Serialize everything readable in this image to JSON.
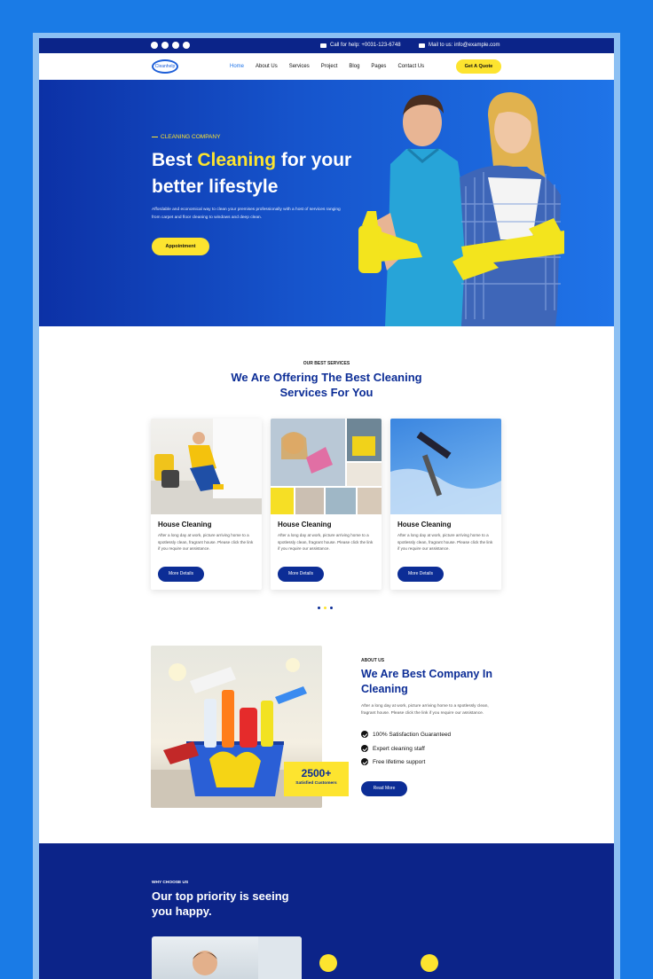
{
  "topbar": {
    "social_icons": [
      "facebook-icon",
      "instagram-icon",
      "twitter-icon",
      "dribbble-icon"
    ],
    "phone_text": "Call for help: +0031-123-6748",
    "mail_text": "Mail to us: info@example.com"
  },
  "nav": {
    "logo_text": "Cleanhelp",
    "items": [
      "Home",
      "About Us",
      "Services",
      "Project",
      "Blog",
      "Pages",
      "Contact Us"
    ],
    "active": "Home",
    "cta": "Get A Quote"
  },
  "hero": {
    "eyebrow": "CLEANING COMPANY",
    "title_part1": "Best ",
    "title_highlight": "Cleaning",
    "title_part2": " for your better lifestyle",
    "description": "Affordable and economical way to clean your premises professionally with a host of services ranging from carpet and floor cleaning to windows and deep clean.",
    "button": "Appointment"
  },
  "services": {
    "eyebrow": "OUR BEST SERVICES",
    "title": "We Are Offering The Best Cleaning Services For You",
    "cards": [
      {
        "title": "House Cleaning",
        "text": "After a long day at work, picture arriving home to a spotlessly clean, fragrant house. Please click the link if you require our assistance.",
        "button": "More Details"
      },
      {
        "title": "House Cleaning",
        "text": "After a long day at work, picture arriving home to a spotlessly clean, fragrant house. Please click the link if you require our assistance.",
        "button": "More Details"
      },
      {
        "title": "House Cleaning",
        "text": "After a long day at work, picture arriving home to a spotlessly clean, fragrant house. Please click the link if you require our assistance.",
        "button": "More Details"
      }
    ]
  },
  "about": {
    "eyebrow": "ABOUT US",
    "title": "We Are Best Company In Cleaning",
    "text": "After a long day at work, picture arriving home to a spotlessly clean, fragrant house. Please click the link if you require our assistance.",
    "features": [
      "100% Satisfaction Guaranteed",
      "Expert cleaning staff",
      "Free lifetime support"
    ],
    "badge_number": "2500+",
    "badge_label": "Satisfied Customers",
    "button": "Read More"
  },
  "why": {
    "eyebrow": "WHY CHOOSE US",
    "title": "Our top priority is seeing you happy."
  },
  "colors": {
    "brand_blue": "#0c2d96",
    "accent_yellow": "#fde42f",
    "hero_blue": "#1f74e8"
  }
}
